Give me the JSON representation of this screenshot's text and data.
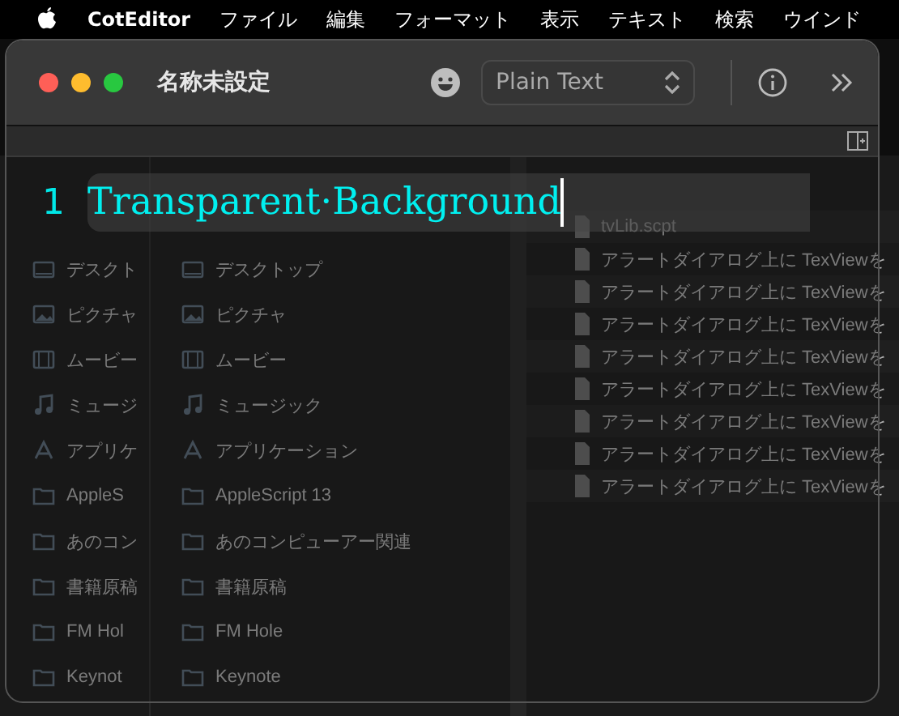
{
  "menu_bar": {
    "app_name": "CotEditor",
    "items": [
      "ファイル",
      "編集",
      "フォーマット",
      "表示",
      "テキスト",
      "検索",
      "ウインド"
    ]
  },
  "background_finder": {
    "columns": [
      {
        "items": [
          {
            "kind": "desktop",
            "label": "デスクト"
          },
          {
            "kind": "pictures",
            "label": "ピクチャ"
          },
          {
            "kind": "movies",
            "label": "ムービー"
          },
          {
            "kind": "music",
            "label": "ミュージ"
          },
          {
            "kind": "applications",
            "label": "アプリケ"
          },
          {
            "kind": "folder",
            "label": "AppleS"
          },
          {
            "kind": "folder",
            "label": "あのコン"
          },
          {
            "kind": "folder",
            "label": "書籍原稿"
          },
          {
            "kind": "folder",
            "label": "FM Hol"
          },
          {
            "kind": "folder",
            "label": "Keynot"
          }
        ]
      },
      {
        "items": [
          {
            "kind": "desktop",
            "label": "デスクトップ"
          },
          {
            "kind": "pictures",
            "label": "ピクチャ"
          },
          {
            "kind": "movies",
            "label": "ムービー"
          },
          {
            "kind": "music",
            "label": "ミュージック"
          },
          {
            "kind": "applications",
            "label": "アプリケーション"
          },
          {
            "kind": "folder",
            "label": "AppleScript 13"
          },
          {
            "kind": "folder",
            "label": "あのコンピューアー関連"
          },
          {
            "kind": "folder",
            "label": "書籍原稿"
          },
          {
            "kind": "folder",
            "label": "FM Hole"
          },
          {
            "kind": "folder",
            "label": "Keynote"
          }
        ]
      },
      {
        "items": [
          {
            "kind": "file",
            "label": "tvLib.scpt"
          },
          {
            "kind": "file",
            "label": "アラートダイアログ上に TexViewを"
          },
          {
            "kind": "file",
            "label": "アラートダイアログ上に TexViewを"
          },
          {
            "kind": "file",
            "label": "アラートダイアログ上に TexViewを"
          },
          {
            "kind": "file",
            "label": "アラートダイアログ上に TexViewを"
          },
          {
            "kind": "file",
            "label": "アラートダイアログ上に TexViewを"
          },
          {
            "kind": "file",
            "label": "アラートダイアログ上に TexViewを"
          },
          {
            "kind": "file",
            "label": "アラートダイアログ上に TexViewを"
          },
          {
            "kind": "file",
            "label": "アラートダイアログ上に TexViewを"
          }
        ]
      }
    ]
  },
  "window": {
    "title": "名称未設定",
    "syntax": "Plain Text",
    "editor": {
      "lines": [
        {
          "number": "1",
          "text": "Transparent·Background"
        }
      ]
    }
  }
}
